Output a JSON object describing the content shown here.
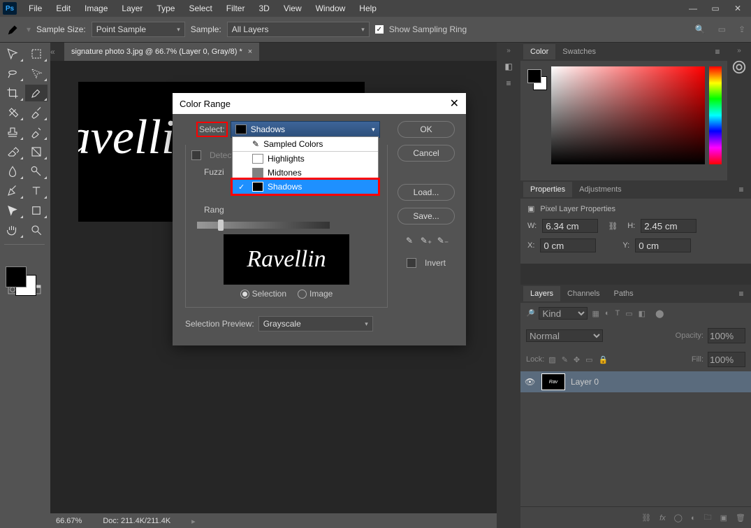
{
  "menu": {
    "items": [
      "File",
      "Edit",
      "Image",
      "Layer",
      "Type",
      "Select",
      "Filter",
      "3D",
      "View",
      "Window",
      "Help"
    ]
  },
  "optionsbar": {
    "sample_size_label": "Sample Size:",
    "sample_size_value": "Point Sample",
    "sample_label": "Sample:",
    "sample_value": "All Layers",
    "show_ring": "Show Sampling Ring"
  },
  "document": {
    "tab": "signature photo 3.jpg @ 66.7% (Layer 0, Gray/8) *",
    "zoom": "66.67%",
    "doc_label": "Doc:",
    "doc_size": "211.4K/211.4K",
    "signature": "Ravellin"
  },
  "dialog": {
    "title": "Color Range",
    "select_label": "Select:",
    "select_value": "Shadows",
    "options": {
      "sampled": "Sampled Colors",
      "highlights": "Highlights",
      "midtones": "Midtones",
      "shadows": "Shadows"
    },
    "detect_faces": "Detect F",
    "fuzziness": "Fuzzi",
    "range": "Rang",
    "selection": "Selection",
    "image": "Image",
    "selection_preview": "Selection Preview:",
    "selection_preview_value": "Grayscale",
    "ok": "OK",
    "cancel": "Cancel",
    "load": "Load...",
    "save": "Save...",
    "invert": "Invert"
  },
  "panels": {
    "color": "Color",
    "swatches": "Swatches",
    "properties": "Properties",
    "adjustments": "Adjustments",
    "pixel_layer": "Pixel Layer Properties",
    "w": "W:",
    "w_val": "6.34 cm",
    "h": "H:",
    "h_val": "2.45 cm",
    "x": "X:",
    "x_val": "0 cm",
    "y": "Y:",
    "y_val": "0 cm",
    "layers": "Layers",
    "channels": "Channels",
    "paths": "Paths",
    "kind": "Kind",
    "normal": "Normal",
    "opacity": "Opacity:",
    "opacity_val": "100%",
    "lock": "Lock:",
    "fill": "Fill:",
    "fill_val": "100%",
    "layer0": "Layer 0"
  }
}
